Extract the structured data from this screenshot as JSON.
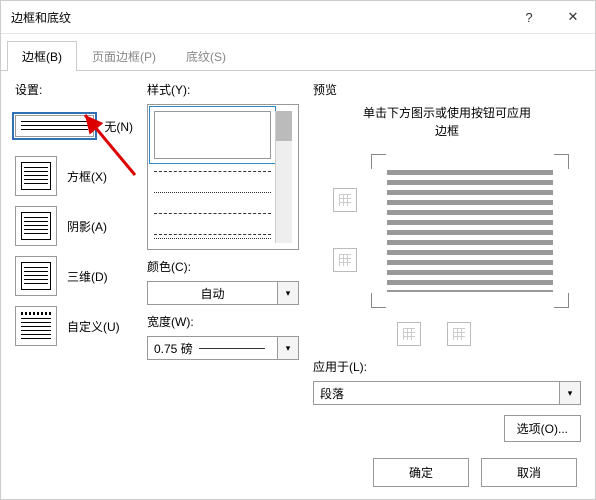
{
  "title": "边框和底纹",
  "tabs": {
    "border": "边框(B)",
    "page": "页面边框(P)",
    "shading": "底纹(S)"
  },
  "settings": {
    "label": "设置:",
    "none": "无(N)",
    "box": "方框(X)",
    "shadow": "阴影(A)",
    "threed": "三维(D)",
    "custom": "自定义(U)"
  },
  "style": {
    "label": "样式(Y):",
    "color": "颜色(C):",
    "color_val": "自动",
    "width": "宽度(W):",
    "width_val": "0.75 磅"
  },
  "preview": {
    "label": "预览",
    "hint1": "单击下方图示或使用按钮可应用",
    "hint2": "边框",
    "apply": "应用于(L):",
    "apply_val": "段落",
    "options": "选项(O)..."
  },
  "footer": {
    "ok": "确定",
    "cancel": "取消"
  },
  "help": "?",
  "close": "✕"
}
